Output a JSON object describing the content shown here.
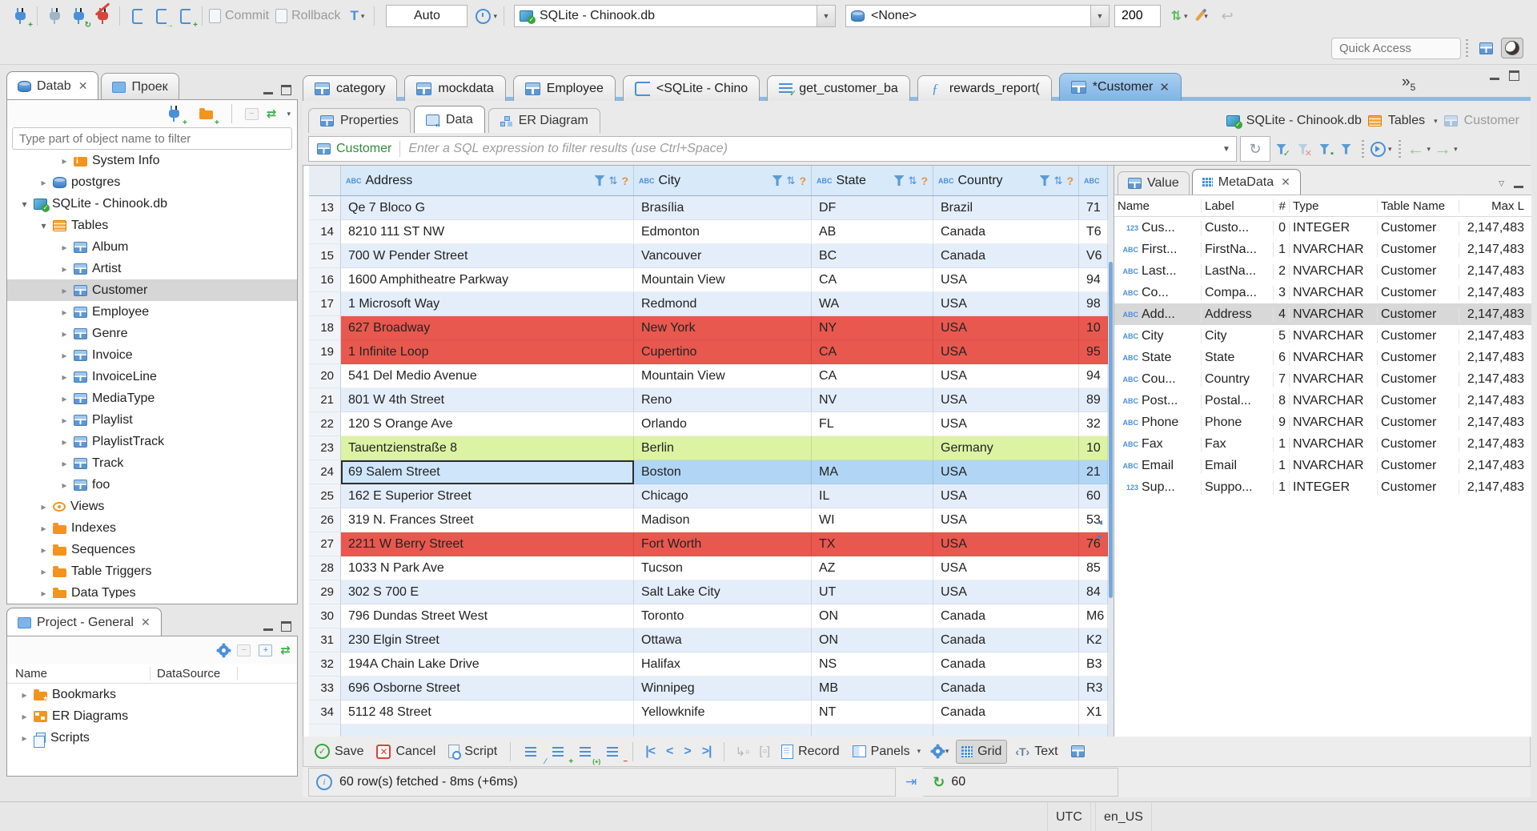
{
  "colors": {
    "accent_blue": "#4a90d9",
    "orange": "#f2941d",
    "row_stripe": "#e4eefa",
    "row_red": "#e8584e",
    "row_green": "#ddf3a4",
    "row_selected": "#b1d6f5",
    "header_blue": "#d8e9f9",
    "green": "#3ba53f"
  },
  "top": {
    "commit": "Commit",
    "rollback": "Rollback",
    "auto": "Auto",
    "datasource": "SQLite - Chinook.db",
    "schema": "<None>",
    "fetch_size": "200",
    "quick_access": "Quick Access"
  },
  "nav": {
    "tab_database": "Datab",
    "tab_project": "Проек",
    "filter_placeholder": "Type part of object name to filter",
    "tree": [
      {
        "label": "System Info",
        "icon": "folderinfo",
        "arrow": "right",
        "depth": 3
      },
      {
        "label": "postgres",
        "icon": "db",
        "arrow": "right",
        "depth": 2
      },
      {
        "label": "SQLite - Chinook.db",
        "icon": "sqlite",
        "arrow": "down",
        "depth": 1
      },
      {
        "label": "Tables",
        "icon": "ftable",
        "arrow": "down",
        "depth": 2
      },
      {
        "label": "Album",
        "icon": "table",
        "arrow": "right",
        "depth": 3
      },
      {
        "label": "Artist",
        "icon": "table",
        "arrow": "right",
        "depth": 3
      },
      {
        "label": "Customer",
        "icon": "table",
        "arrow": "right",
        "depth": 3,
        "sel": "sel"
      },
      {
        "label": "Employee",
        "icon": "table",
        "arrow": "right",
        "depth": 3
      },
      {
        "label": "Genre",
        "icon": "table",
        "arrow": "right",
        "depth": 3
      },
      {
        "label": "Invoice",
        "icon": "table",
        "arrow": "right",
        "depth": 3
      },
      {
        "label": "InvoiceLine",
        "icon": "table",
        "arrow": "right",
        "depth": 3
      },
      {
        "label": "MediaType",
        "icon": "table",
        "arrow": "right",
        "depth": 3
      },
      {
        "label": "Playlist",
        "icon": "table",
        "arrow": "right",
        "depth": 3
      },
      {
        "label": "PlaylistTrack",
        "icon": "table",
        "arrow": "right",
        "depth": 3
      },
      {
        "label": "Track",
        "icon": "table",
        "arrow": "right",
        "depth": 3
      },
      {
        "label": "foo",
        "icon": "table",
        "arrow": "right",
        "depth": 3
      },
      {
        "label": "Views",
        "icon": "views",
        "arrow": "right",
        "depth": 2
      },
      {
        "label": "Indexes",
        "icon": "folder",
        "arrow": "right",
        "depth": 2
      },
      {
        "label": "Sequences",
        "icon": "folder",
        "arrow": "right",
        "depth": 2
      },
      {
        "label": "Table Triggers",
        "icon": "folder",
        "arrow": "right",
        "depth": 2
      },
      {
        "label": "Data Types",
        "icon": "folder",
        "arrow": "right",
        "depth": 2
      }
    ]
  },
  "project": {
    "title": "Project - General",
    "col_name": "Name",
    "col_datasource": "DataSource",
    "items": [
      {
        "label": "Bookmarks",
        "icon": "bmk",
        "arrow": "right"
      },
      {
        "label": "ER Diagrams",
        "icon": "erd",
        "arrow": "right"
      },
      {
        "label": "Scripts",
        "icon": "scripts",
        "arrow": "right"
      }
    ]
  },
  "editor": {
    "tabs": [
      {
        "label": "category",
        "icon": "table"
      },
      {
        "label": "mockdata",
        "icon": "table"
      },
      {
        "label": "Employee",
        "icon": "table"
      },
      {
        "label": "<SQLite - Chino",
        "icon": "sql"
      },
      {
        "label": "get_customer_ba",
        "icon": "sqlc"
      },
      {
        "label": "rewards_report(",
        "icon": "fn"
      },
      {
        "label": "*Customer",
        "icon": "table",
        "state": "active",
        "x": "y"
      }
    ],
    "more_count": "5"
  },
  "result": {
    "tab_properties": "Properties",
    "tab_data": "Data",
    "tab_er": "ER Diagram",
    "crumb_db": "SQLite - Chinook.db",
    "crumb_tables": "Tables",
    "crumb_entity": "Customer"
  },
  "filter": {
    "table": "Customer",
    "placeholder": "Enter a SQL expression to filter results (use Ctrl+Space)"
  },
  "grid": {
    "cols": [
      {
        "t": "ABC",
        "label": "Address"
      },
      {
        "t": "ABC",
        "label": "City"
      },
      {
        "t": "ABC",
        "label": "State"
      },
      {
        "t": "ABC",
        "label": "Country"
      }
    ],
    "partial_t": "ABC",
    "rows": [
      {
        "num": "13",
        "address": "Qe 7 Bloco G",
        "city": "Brasília",
        "state": "DF",
        "country": "Brazil",
        "pc": "71",
        "hl": "odd"
      },
      {
        "num": "14",
        "address": "8210 111 ST NW",
        "city": "Edmonton",
        "state": "AB",
        "country": "Canada",
        "pc": "T6",
        "hl": "even"
      },
      {
        "num": "15",
        "address": "700 W Pender Street",
        "city": "Vancouver",
        "state": "BC",
        "country": "Canada",
        "pc": "V6",
        "hl": "odd"
      },
      {
        "num": "16",
        "address": "1600 Amphitheatre Parkway",
        "city": "Mountain View",
        "state": "CA",
        "country": "USA",
        "pc": "94",
        "hl": "even"
      },
      {
        "num": "17",
        "address": "1 Microsoft Way",
        "city": "Redmond",
        "state": "WA",
        "country": "USA",
        "pc": "98",
        "hl": "odd"
      },
      {
        "num": "18",
        "address": "627 Broadway",
        "city": "New York",
        "state": "NY",
        "country": "USA",
        "pc": "10",
        "hl": "red"
      },
      {
        "num": "19",
        "address": "1 Infinite Loop",
        "city": "Cupertino",
        "state": "CA",
        "country": "USA",
        "pc": "95",
        "hl": "red"
      },
      {
        "num": "20",
        "address": "541 Del Medio Avenue",
        "city": "Mountain View",
        "state": "CA",
        "country": "USA",
        "pc": "94",
        "hl": "even"
      },
      {
        "num": "21",
        "address": "801 W 4th Street",
        "city": "Reno",
        "state": "NV",
        "country": "USA",
        "pc": "89",
        "hl": "odd"
      },
      {
        "num": "22",
        "address": "120 S Orange Ave",
        "city": "Orlando",
        "state": "FL",
        "country": "USA",
        "pc": "32",
        "hl": "even"
      },
      {
        "num": "23",
        "address": "Tauentzienstraße 8",
        "city": "Berlin",
        "state": "",
        "country": "Germany",
        "pc": "10",
        "hl": "green"
      },
      {
        "num": "24",
        "address": "69 Salem Street",
        "city": "Boston",
        "state": "MA",
        "country": "USA",
        "pc": "21",
        "hl": "sel",
        "focus": "y"
      },
      {
        "num": "25",
        "address": "162 E Superior Street",
        "city": "Chicago",
        "state": "IL",
        "country": "USA",
        "pc": "60",
        "hl": "odd"
      },
      {
        "num": "26",
        "address": "319 N. Frances Street",
        "city": "Madison",
        "state": "WI",
        "country": "USA",
        "pc": "53",
        "hl": "even"
      },
      {
        "num": "27",
        "address": "2211 W Berry Street",
        "city": "Fort Worth",
        "state": "TX",
        "country": "USA",
        "pc": "76",
        "hl": "red"
      },
      {
        "num": "28",
        "address": "1033 N Park Ave",
        "city": "Tucson",
        "state": "AZ",
        "country": "USA",
        "pc": "85",
        "hl": "even"
      },
      {
        "num": "29",
        "address": "302 S 700 E",
        "city": "Salt Lake City",
        "state": "UT",
        "country": "USA",
        "pc": "84",
        "hl": "odd"
      },
      {
        "num": "30",
        "address": "796 Dundas Street West",
        "city": "Toronto",
        "state": "ON",
        "country": "Canada",
        "pc": "M6",
        "hl": "even"
      },
      {
        "num": "31",
        "address": "230 Elgin Street",
        "city": "Ottawa",
        "state": "ON",
        "country": "Canada",
        "pc": "K2",
        "hl": "odd"
      },
      {
        "num": "32",
        "address": "194A Chain Lake Drive",
        "city": "Halifax",
        "state": "NS",
        "country": "Canada",
        "pc": "B3",
        "hl": "even"
      },
      {
        "num": "33",
        "address": "696 Osborne Street",
        "city": "Winnipeg",
        "state": "MB",
        "country": "Canada",
        "pc": "R3",
        "hl": "odd"
      },
      {
        "num": "34",
        "address": "5112 48 Street",
        "city": "Yellowknife",
        "state": "NT",
        "country": "Canada",
        "pc": "X1",
        "hl": "even"
      },
      {
        "num": "",
        "address": "",
        "city": "",
        "state": "",
        "country": "",
        "pc": "",
        "hl": "odd"
      }
    ]
  },
  "meta": {
    "tab_value": "Value",
    "tab_meta": "MetaData",
    "cols": [
      "Name",
      "Label",
      "#",
      "Type",
      "Table Name",
      "Max L"
    ],
    "rows": [
      {
        "t": "123",
        "name": "Cus...",
        "label": "Custo...",
        "num": "0",
        "type": "INTEGER",
        "table": "Customer",
        "max": "2,147,483"
      },
      {
        "t": "ABC",
        "name": "First...",
        "label": "FirstNa...",
        "num": "1",
        "type": "NVARCHAR",
        "table": "Customer",
        "max": "2,147,483"
      },
      {
        "t": "ABC",
        "name": "Last...",
        "label": "LastNa...",
        "num": "2",
        "type": "NVARCHAR",
        "table": "Customer",
        "max": "2,147,483"
      },
      {
        "t": "ABC",
        "name": "Co...",
        "label": "Compa...",
        "num": "3",
        "type": "NVARCHAR",
        "table": "Customer",
        "max": "2,147,483"
      },
      {
        "t": "ABC",
        "name": "Add...",
        "label": "Address",
        "num": "4",
        "type": "NVARCHAR",
        "table": "Customer",
        "max": "2,147,483",
        "sel": "sel"
      },
      {
        "t": "ABC",
        "name": "City",
        "label": "City",
        "num": "5",
        "type": "NVARCHAR",
        "table": "Customer",
        "max": "2,147,483"
      },
      {
        "t": "ABC",
        "name": "State",
        "label": "State",
        "num": "6",
        "type": "NVARCHAR",
        "table": "Customer",
        "max": "2,147,483"
      },
      {
        "t": "ABC",
        "name": "Cou...",
        "label": "Country",
        "num": "7",
        "type": "NVARCHAR",
        "table": "Customer",
        "max": "2,147,483"
      },
      {
        "t": "ABC",
        "name": "Post...",
        "label": "Postal...",
        "num": "8",
        "type": "NVARCHAR",
        "table": "Customer",
        "max": "2,147,483"
      },
      {
        "t": "ABC",
        "name": "Phone",
        "label": "Phone",
        "num": "9",
        "type": "NVARCHAR",
        "table": "Customer",
        "max": "2,147,483"
      },
      {
        "t": "ABC",
        "name": "Fax",
        "label": "Fax",
        "num": "1",
        "type": "NVARCHAR",
        "table": "Customer",
        "max": "2,147,483"
      },
      {
        "t": "ABC",
        "name": "Email",
        "label": "Email",
        "num": "1",
        "type": "NVARCHAR",
        "table": "Customer",
        "max": "2,147,483"
      },
      {
        "t": "123",
        "name": "Sup...",
        "label": "Suppo...",
        "num": "1",
        "type": "INTEGER",
        "table": "Customer",
        "max": "2,147,483"
      }
    ]
  },
  "toolbar2": {
    "save": "Save",
    "cancel": "Cancel",
    "script": "Script",
    "record": "Record",
    "panels": "Panels",
    "grid": "Grid",
    "text": "Text"
  },
  "status": {
    "message": "60 row(s) fetched - 8ms (+6ms)",
    "count": "60"
  },
  "statusbar": {
    "tz": "UTC",
    "locale": "en_US"
  }
}
